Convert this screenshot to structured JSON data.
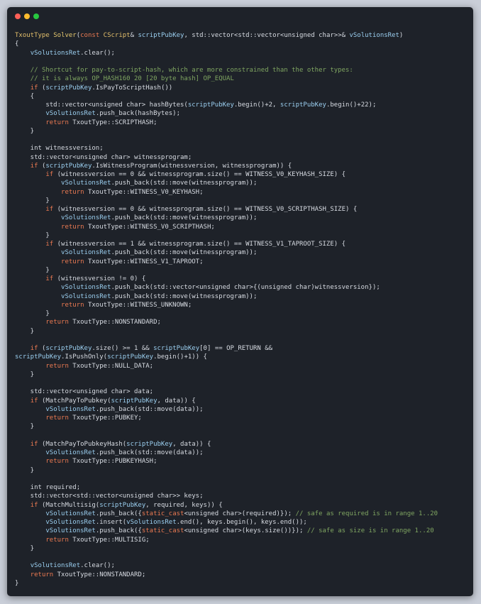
{
  "colors": {
    "plain": "#d7dbe2",
    "keyword": "#ec7a52",
    "type": "#e3bf6b",
    "function": "#e6c86e",
    "variable": "#9bcff0",
    "comment": "#7fa561",
    "number": "#d7dbe2",
    "window_close": "#ff5f57",
    "window_minimize": "#febc2e",
    "window_maximize": "#28c840"
  },
  "window": {
    "buttons": [
      "close-icon",
      "minimize-icon",
      "maximize-icon"
    ]
  },
  "code": {
    "lines": [
      [
        [
          "type",
          "TxoutType"
        ],
        [
          "plain",
          " "
        ],
        [
          "function",
          "Solver"
        ],
        [
          "plain",
          "("
        ],
        [
          "keyword",
          "const"
        ],
        [
          "plain",
          " "
        ],
        [
          "type",
          "CScript"
        ],
        [
          "plain",
          "& "
        ],
        [
          "variable",
          "scriptPubKey"
        ],
        [
          "plain",
          ", std::vector<std::vector<unsigned char>>& "
        ],
        [
          "variable",
          "vSolutionsRet"
        ],
        [
          "plain",
          ")"
        ]
      ],
      [
        [
          "plain",
          "{"
        ]
      ],
      [
        [
          "plain",
          "    "
        ],
        [
          "variable",
          "vSolutionsRet"
        ],
        [
          "plain",
          ".clear();"
        ]
      ],
      [],
      [
        [
          "plain",
          "    "
        ],
        [
          "comment",
          "// Shortcut for pay-to-script-hash, which are more constrained than the other types:"
        ]
      ],
      [
        [
          "plain",
          "    "
        ],
        [
          "comment",
          "// it is always OP_HASH160 20 [20 byte hash] OP_EQUAL"
        ]
      ],
      [
        [
          "plain",
          "    "
        ],
        [
          "keyword",
          "if"
        ],
        [
          "plain",
          " ("
        ],
        [
          "variable",
          "scriptPubKey"
        ],
        [
          "plain",
          ".IsPayToScriptHash())"
        ]
      ],
      [
        [
          "plain",
          "    {"
        ]
      ],
      [
        [
          "plain",
          "        std::vector<unsigned char> hashBytes("
        ],
        [
          "variable",
          "scriptPubKey"
        ],
        [
          "plain",
          ".begin()+2, "
        ],
        [
          "variable",
          "scriptPubKey"
        ],
        [
          "plain",
          ".begin()+22);"
        ]
      ],
      [
        [
          "plain",
          "        "
        ],
        [
          "variable",
          "vSolutionsRet"
        ],
        [
          "plain",
          ".push_back(hashBytes);"
        ]
      ],
      [
        [
          "plain",
          "        "
        ],
        [
          "keyword",
          "return"
        ],
        [
          "plain",
          " TxoutType::SCRIPTHASH;"
        ]
      ],
      [
        [
          "plain",
          "    }"
        ]
      ],
      [],
      [
        [
          "plain",
          "    int witnessversion;"
        ]
      ],
      [
        [
          "plain",
          "    std::vector<unsigned char> witnessprogram;"
        ]
      ],
      [
        [
          "plain",
          "    "
        ],
        [
          "keyword",
          "if"
        ],
        [
          "plain",
          " ("
        ],
        [
          "variable",
          "scriptPubKey"
        ],
        [
          "plain",
          ".IsWitnessProgram(witnessversion, witnessprogram)) {"
        ]
      ],
      [
        [
          "plain",
          "        "
        ],
        [
          "keyword",
          "if"
        ],
        [
          "plain",
          " (witnessversion == 0 && witnessprogram.size() == WITNESS_V0_KEYHASH_SIZE) {"
        ]
      ],
      [
        [
          "plain",
          "            "
        ],
        [
          "variable",
          "vSolutionsRet"
        ],
        [
          "plain",
          ".push_back(std::move(witnessprogram));"
        ]
      ],
      [
        [
          "plain",
          "            "
        ],
        [
          "keyword",
          "return"
        ],
        [
          "plain",
          " TxoutType::WITNESS_V0_KEYHASH;"
        ]
      ],
      [
        [
          "plain",
          "        }"
        ]
      ],
      [
        [
          "plain",
          "        "
        ],
        [
          "keyword",
          "if"
        ],
        [
          "plain",
          " (witnessversion == 0 && witnessprogram.size() == WITNESS_V0_SCRIPTHASH_SIZE) {"
        ]
      ],
      [
        [
          "plain",
          "            "
        ],
        [
          "variable",
          "vSolutionsRet"
        ],
        [
          "plain",
          ".push_back(std::move(witnessprogram));"
        ]
      ],
      [
        [
          "plain",
          "            "
        ],
        [
          "keyword",
          "return"
        ],
        [
          "plain",
          " TxoutType::WITNESS_V0_SCRIPTHASH;"
        ]
      ],
      [
        [
          "plain",
          "        }"
        ]
      ],
      [
        [
          "plain",
          "        "
        ],
        [
          "keyword",
          "if"
        ],
        [
          "plain",
          " (witnessversion == 1 && witnessprogram.size() == WITNESS_V1_TAPROOT_SIZE) {"
        ]
      ],
      [
        [
          "plain",
          "            "
        ],
        [
          "variable",
          "vSolutionsRet"
        ],
        [
          "plain",
          ".push_back(std::move(witnessprogram));"
        ]
      ],
      [
        [
          "plain",
          "            "
        ],
        [
          "keyword",
          "return"
        ],
        [
          "plain",
          " TxoutType::WITNESS_V1_TAPROOT;"
        ]
      ],
      [
        [
          "plain",
          "        }"
        ]
      ],
      [
        [
          "plain",
          "        "
        ],
        [
          "keyword",
          "if"
        ],
        [
          "plain",
          " (witnessversion != 0) {"
        ]
      ],
      [
        [
          "plain",
          "            "
        ],
        [
          "variable",
          "vSolutionsRet"
        ],
        [
          "plain",
          ".push_back(std::vector<unsigned char>{(unsigned char)witnessversion});"
        ]
      ],
      [
        [
          "plain",
          "            "
        ],
        [
          "variable",
          "vSolutionsRet"
        ],
        [
          "plain",
          ".push_back(std::move(witnessprogram));"
        ]
      ],
      [
        [
          "plain",
          "            "
        ],
        [
          "keyword",
          "return"
        ],
        [
          "plain",
          " TxoutType::WITNESS_UNKNOWN;"
        ]
      ],
      [
        [
          "plain",
          "        }"
        ]
      ],
      [
        [
          "plain",
          "        "
        ],
        [
          "keyword",
          "return"
        ],
        [
          "plain",
          " TxoutType::NONSTANDARD;"
        ]
      ],
      [
        [
          "plain",
          "    }"
        ]
      ],
      [],
      [
        [
          "plain",
          "    "
        ],
        [
          "keyword",
          "if"
        ],
        [
          "plain",
          " ("
        ],
        [
          "variable",
          "scriptPubKey"
        ],
        [
          "plain",
          ".size() >= 1 && "
        ],
        [
          "variable",
          "scriptPubKey"
        ],
        [
          "plain",
          "[0] == OP_RETURN &&"
        ]
      ],
      [
        [
          "variable",
          "scriptPubKey"
        ],
        [
          "plain",
          ".IsPushOnly("
        ],
        [
          "variable",
          "scriptPubKey"
        ],
        [
          "plain",
          ".begin()+1)) {"
        ]
      ],
      [
        [
          "plain",
          "        "
        ],
        [
          "keyword",
          "return"
        ],
        [
          "plain",
          " TxoutType::NULL_DATA;"
        ]
      ],
      [
        [
          "plain",
          "    }"
        ]
      ],
      [],
      [
        [
          "plain",
          "    std::vector<unsigned char> data;"
        ]
      ],
      [
        [
          "plain",
          "    "
        ],
        [
          "keyword",
          "if"
        ],
        [
          "plain",
          " (MatchPayToPubkey("
        ],
        [
          "variable",
          "scriptPubKey"
        ],
        [
          "plain",
          ", data)) {"
        ]
      ],
      [
        [
          "plain",
          "        "
        ],
        [
          "variable",
          "vSolutionsRet"
        ],
        [
          "plain",
          ".push_back(std::move(data));"
        ]
      ],
      [
        [
          "plain",
          "        "
        ],
        [
          "keyword",
          "return"
        ],
        [
          "plain",
          " TxoutType::PUBKEY;"
        ]
      ],
      [
        [
          "plain",
          "    }"
        ]
      ],
      [],
      [
        [
          "plain",
          "    "
        ],
        [
          "keyword",
          "if"
        ],
        [
          "plain",
          " (MatchPayToPubkeyHash("
        ],
        [
          "variable",
          "scriptPubKey"
        ],
        [
          "plain",
          ", data)) {"
        ]
      ],
      [
        [
          "plain",
          "        "
        ],
        [
          "variable",
          "vSolutionsRet"
        ],
        [
          "plain",
          ".push_back(std::move(data));"
        ]
      ],
      [
        [
          "plain",
          "        "
        ],
        [
          "keyword",
          "return"
        ],
        [
          "plain",
          " TxoutType::PUBKEYHASH;"
        ]
      ],
      [
        [
          "plain",
          "    }"
        ]
      ],
      [],
      [
        [
          "plain",
          "    int required;"
        ]
      ],
      [
        [
          "plain",
          "    std::vector<std::vector<unsigned char>> keys;"
        ]
      ],
      [
        [
          "plain",
          "    "
        ],
        [
          "keyword",
          "if"
        ],
        [
          "plain",
          " (MatchMultisig("
        ],
        [
          "variable",
          "scriptPubKey"
        ],
        [
          "plain",
          ", required, keys)) {"
        ]
      ],
      [
        [
          "plain",
          "        "
        ],
        [
          "variable",
          "vSolutionsRet"
        ],
        [
          "plain",
          ".push_back({"
        ],
        [
          "keyword",
          "static_cast"
        ],
        [
          "plain",
          "<unsigned char>(required)}); "
        ],
        [
          "comment",
          "// safe as required is in range 1..20"
        ]
      ],
      [
        [
          "plain",
          "        "
        ],
        [
          "variable",
          "vSolutionsRet"
        ],
        [
          "plain",
          ".insert("
        ],
        [
          "variable",
          "vSolutionsRet"
        ],
        [
          "plain",
          ".end(), keys.begin(), keys.end());"
        ]
      ],
      [
        [
          "plain",
          "        "
        ],
        [
          "variable",
          "vSolutionsRet"
        ],
        [
          "plain",
          ".push_back({"
        ],
        [
          "keyword",
          "static_cast"
        ],
        [
          "plain",
          "<unsigned char>(keys.size())}); "
        ],
        [
          "comment",
          "// safe as size is in range 1..20"
        ]
      ],
      [
        [
          "plain",
          "        "
        ],
        [
          "keyword",
          "return"
        ],
        [
          "plain",
          " TxoutType::MULTISIG;"
        ]
      ],
      [
        [
          "plain",
          "    }"
        ]
      ],
      [],
      [
        [
          "plain",
          "    "
        ],
        [
          "variable",
          "vSolutionsRet"
        ],
        [
          "plain",
          ".clear();"
        ]
      ],
      [
        [
          "plain",
          "    "
        ],
        [
          "keyword",
          "return"
        ],
        [
          "plain",
          " TxoutType::NONSTANDARD;"
        ]
      ],
      [
        [
          "plain",
          "}"
        ]
      ]
    ]
  }
}
